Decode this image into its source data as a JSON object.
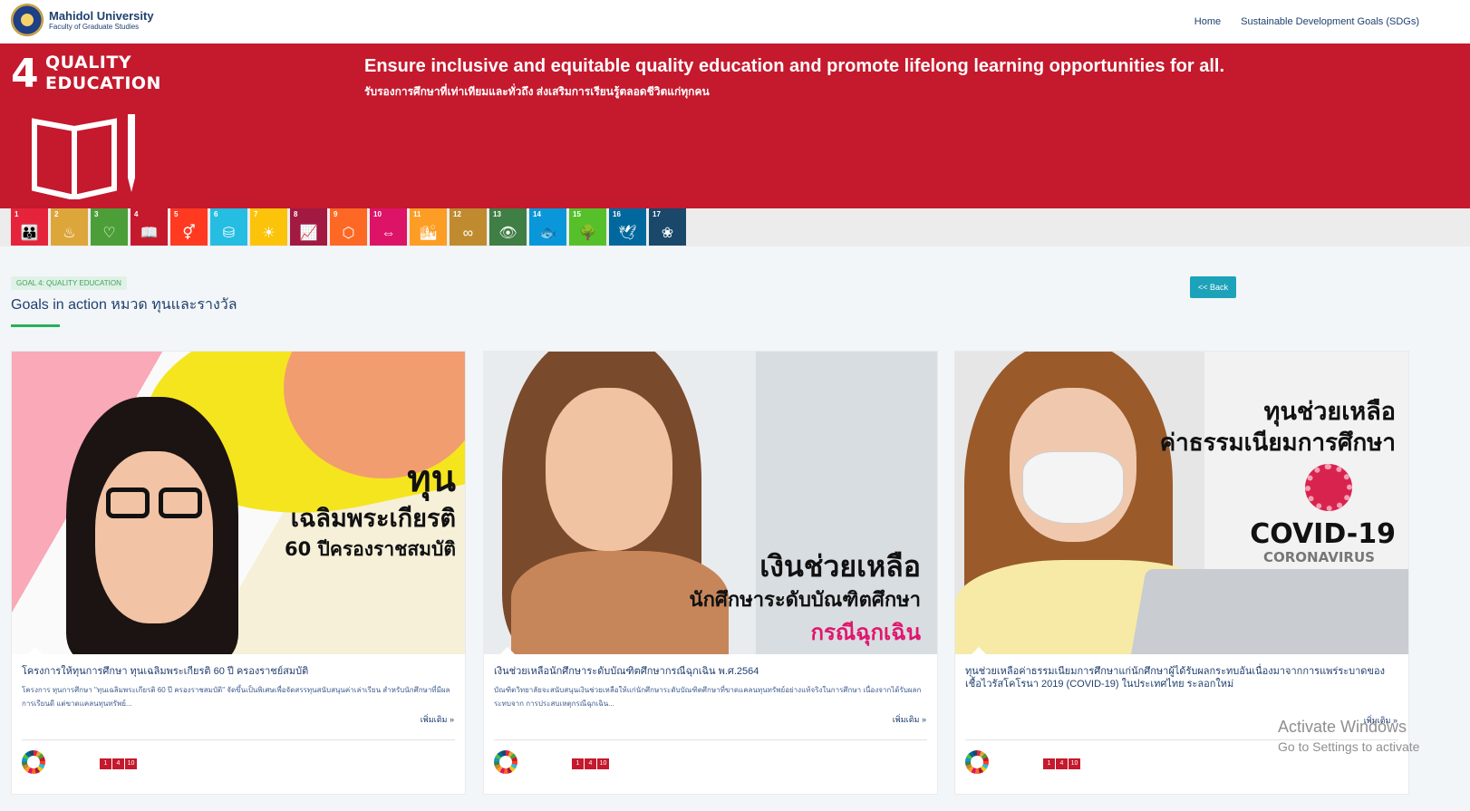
{
  "header": {
    "logo_line1": "Mahidol University",
    "logo_line2": "Faculty of Graduate Studies",
    "nav": [
      "Home",
      "Sustainable Development Goals (SDGs)"
    ]
  },
  "hero": {
    "goal_number": "4",
    "goal_name_line1": "QUALITY",
    "goal_name_line2": "EDUCATION",
    "title_en": "Ensure inclusive and equitable quality education and promote lifelong learning opportunities for all.",
    "title_th": "รับรองการศึกษาที่เท่าเทียมและทั่วถึง ส่งเสริมการเรียนรู้ตลอดชีวิตแก่ทุกคน",
    "color": "#c5192d"
  },
  "sdg_tiles": [
    {
      "num": "1",
      "color": "#e5243b",
      "glyph": "👪"
    },
    {
      "num": "2",
      "color": "#dda63a",
      "glyph": "♨"
    },
    {
      "num": "3",
      "color": "#4c9f38",
      "glyph": "♡"
    },
    {
      "num": "4",
      "color": "#c5192d",
      "glyph": "📖"
    },
    {
      "num": "5",
      "color": "#ff3a21",
      "glyph": "⚥"
    },
    {
      "num": "6",
      "color": "#26bde2",
      "glyph": "⛁"
    },
    {
      "num": "7",
      "color": "#fcc30b",
      "glyph": "☀"
    },
    {
      "num": "8",
      "color": "#a21942",
      "glyph": "📈"
    },
    {
      "num": "9",
      "color": "#fd6925",
      "glyph": "⬡"
    },
    {
      "num": "10",
      "color": "#dd1367",
      "glyph": "⇔"
    },
    {
      "num": "11",
      "color": "#fd9d24",
      "glyph": "🏙"
    },
    {
      "num": "12",
      "color": "#bf8b2e",
      "glyph": "∞"
    },
    {
      "num": "13",
      "color": "#3f7e44",
      "glyph": "👁"
    },
    {
      "num": "14",
      "color": "#0a97d9",
      "glyph": "🐟"
    },
    {
      "num": "15",
      "color": "#56c02b",
      "glyph": "🌳"
    },
    {
      "num": "16",
      "color": "#00689d",
      "glyph": "🕊"
    },
    {
      "num": "17",
      "color": "#19486a",
      "glyph": "❀"
    }
  ],
  "section": {
    "badge": "GOAL 4: QUALITY EDUCATION",
    "title": "Goals in action หมวด ทุนและรางวัล",
    "back_label": "<< Back"
  },
  "cards": [
    {
      "title": "โครงการให้ทุนการศึกษา ทุนเฉลิมพระเกียรติ 60 ปี ครองราชย์สมบัติ",
      "desc": "โครงการ ทุนการศึกษา \"ทุนเฉลิมพระเกียรติ 60 ปี ครองราชสมบัติ\" จัดขึ้นเป็นพิเศษเพื่อจัดสรรทุนสนับสนุนค่าเล่าเรียน สำหรับนักศึกษาที่มีผลการเรียนดี แต่ขาดแคลนทุนทรัพย์...",
      "more": "เพิ่มเติม »",
      "tags": [
        "1",
        "4",
        "10"
      ],
      "overlay": [
        "ทุน",
        "เฉลิมพระเกียรติ",
        "60 ปีครองราชสมบัติ"
      ]
    },
    {
      "title": "เงินช่วยเหลือนักศึกษาระดับบัณฑิตศึกษากรณีฉุกเฉิน พ.ศ.2564",
      "desc": "บัณฑิตวิทยาลัยจะสนับสนุนเงินช่วยเหลือให้แก่นักศึกษาระดับบัณฑิตศึกษาที่ขาดแคลนทุนทรัพย์อย่างแท้จริงในการศึกษา เนื่องจากได้รับผลกระทบจาก การประสบเหตุกรณีฉุกเฉิน...",
      "more": "เพิ่มเติม »",
      "tags": [
        "1",
        "4",
        "10"
      ],
      "overlay": [
        "เงินช่วยเหลือ",
        "นักศึกษาระดับบัณฑิตศึกษา",
        "กรณีฉุกเฉิน"
      ]
    },
    {
      "title": "ทุนช่วยเหลือค่าธรรมเนียมการศึกษาแก่นักศึกษาผู้ได้รับผลกระทบอันเนื่องมาจากการแพร่ระบาดของเชื้อไวรัสโคโรนา 2019 (COVID-19) ในประเทศไทย ระลอกใหม่",
      "desc": "",
      "more": "เพิ่มเติม »",
      "tags": [
        "1",
        "4",
        "10"
      ],
      "overlay": [
        "ทุนช่วยเหลือ",
        "ค่าธรรมเนียมการศึกษา",
        "COVID-19",
        "CORONAVIRUS"
      ]
    }
  ],
  "watermark": {
    "line1": "Activate Windows",
    "line2": "Go to Settings to activate"
  }
}
